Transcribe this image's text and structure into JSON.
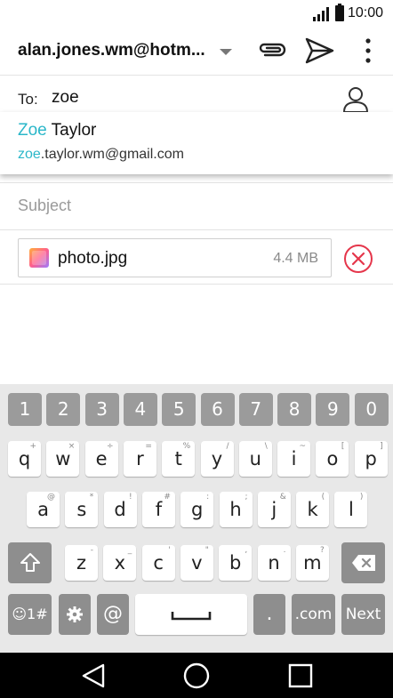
{
  "status_bar": {
    "time": "10:00",
    "signal_icon": "signal-icon",
    "battery_icon": "battery-icon"
  },
  "toolbar": {
    "account": "alan.jones.wm@hotm...",
    "dropdown_icon": "dropdown-arrow-icon",
    "attach_icon": "paperclip-icon",
    "send_icon": "send-icon",
    "overflow_icon": "more-vert-icon"
  },
  "recipients": {
    "to_label": "To:",
    "to_value": "zoe",
    "contact_icon": "person-icon"
  },
  "suggestion": {
    "name_match": "Zoe",
    "name_rest": " Taylor",
    "email_match": "zoe",
    "email_rest": ".taylor.wm@gmail.com",
    "highlight_color": "#2bb7c9"
  },
  "subject": {
    "placeholder": "Subject"
  },
  "attachment": {
    "file_name": "photo.jpg",
    "file_size": "4.4 MB",
    "remove_icon": "remove-circle-icon",
    "remove_color": "#e5364b"
  },
  "keyboard": {
    "numbers": [
      "1",
      "2",
      "3",
      "4",
      "5",
      "6",
      "7",
      "8",
      "9",
      "0"
    ],
    "row1": [
      {
        "k": "q",
        "a": "+"
      },
      {
        "k": "w",
        "a": "×"
      },
      {
        "k": "e",
        "a": "÷"
      },
      {
        "k": "r",
        "a": "="
      },
      {
        "k": "t",
        "a": "%"
      },
      {
        "k": "y",
        "a": "/"
      },
      {
        "k": "u",
        "a": "\\"
      },
      {
        "k": "i",
        "a": "~"
      },
      {
        "k": "o",
        "a": "["
      },
      {
        "k": "p",
        "a": "]"
      }
    ],
    "row2": [
      {
        "k": "a",
        "a": "@"
      },
      {
        "k": "s",
        "a": "*"
      },
      {
        "k": "d",
        "a": "!"
      },
      {
        "k": "f",
        "a": "#"
      },
      {
        "k": "g",
        "a": ":"
      },
      {
        "k": "h",
        "a": ";"
      },
      {
        "k": "j",
        "a": "&"
      },
      {
        "k": "k",
        "a": "("
      },
      {
        "k": "l",
        "a": ")"
      }
    ],
    "row3": [
      {
        "k": "z",
        "a": "-"
      },
      {
        "k": "x",
        "a": "_"
      },
      {
        "k": "c",
        "a": "'"
      },
      {
        "k": "v",
        "a": "\""
      },
      {
        "k": "b",
        "a": ","
      },
      {
        "k": "n",
        "a": "."
      },
      {
        "k": "m",
        "a": "?"
      }
    ],
    "symbols_label": "☺1#",
    "settings_icon": "gear-icon",
    "at_label": "@",
    "space_icon": "space-bar-icon",
    "period_label": ".",
    "com_label": ".com",
    "next_label": "Next",
    "shift_icon": "shift-icon",
    "backspace_icon": "backspace-icon"
  },
  "nav_bar": {
    "back_icon": "back-triangle-icon",
    "home_icon": "home-circle-icon",
    "recents_icon": "recents-square-icon"
  }
}
